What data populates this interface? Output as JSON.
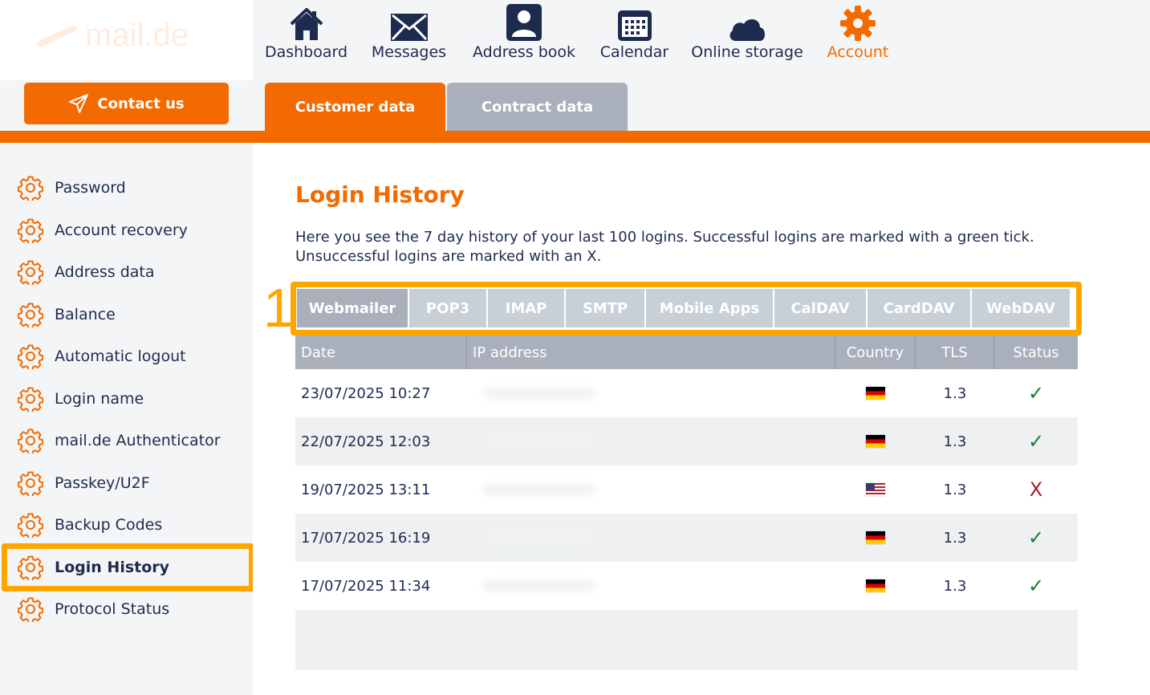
{
  "logo": {
    "text": "mail.de"
  },
  "contact_button": {
    "label": "Contact us"
  },
  "nav": [
    {
      "label": "Dashboard",
      "icon": "house-icon"
    },
    {
      "label": "Messages",
      "icon": "envelope-icon"
    },
    {
      "label": "Address book",
      "icon": "person-card-icon"
    },
    {
      "label": "Calendar",
      "icon": "calendar-icon"
    },
    {
      "label": "Online storage",
      "icon": "cloud-icon"
    },
    {
      "label": "Account",
      "icon": "gear-icon",
      "active": true
    }
  ],
  "tabs": [
    {
      "label": "Customer data",
      "active": true
    },
    {
      "label": "Contract data",
      "active": false
    }
  ],
  "sidebar": {
    "items": [
      {
        "label": "Password"
      },
      {
        "label": "Account recovery"
      },
      {
        "label": "Address data"
      },
      {
        "label": "Balance"
      },
      {
        "label": "Automatic logout"
      },
      {
        "label": "Login name"
      },
      {
        "label": "mail.de Authenticator"
      },
      {
        "label": "Passkey/U2F"
      },
      {
        "label": "Backup Codes"
      },
      {
        "label": "Login History",
        "active": true
      },
      {
        "label": "Protocol Status"
      }
    ]
  },
  "main": {
    "title": "Login History",
    "description": "Here you see the 7 day history of your last 100 logins. Successful logins are marked with a green tick. Unsuccessful logins are marked with an X.",
    "step_number": "1",
    "protocol_tabs": [
      {
        "label": "Webmailer",
        "active": true
      },
      {
        "label": "POP3"
      },
      {
        "label": "IMAP"
      },
      {
        "label": "SMTP"
      },
      {
        "label": "Mobile Apps"
      },
      {
        "label": "CalDAV"
      },
      {
        "label": "CardDAV"
      },
      {
        "label": "WebDAV"
      }
    ],
    "table": {
      "headers": [
        "Date",
        "IP address",
        "Country",
        "TLS",
        "Status"
      ],
      "rows": [
        {
          "date": "23/07/2025 10:27",
          "country": "DE",
          "tls": "1.3",
          "status": "✓",
          "success": true
        },
        {
          "date": "22/07/2025 12:03",
          "country": "DE",
          "tls": "1.3",
          "status": "✓",
          "success": true
        },
        {
          "date": "19/07/2025 13:11",
          "country": "US",
          "tls": "1.3",
          "status": "X",
          "success": false
        },
        {
          "date": "17/07/2025 16:19",
          "country": "DE",
          "tls": "1.3",
          "status": "✓",
          "success": true
        },
        {
          "date": "17/07/2025 11:34",
          "country": "DE",
          "tls": "1.3",
          "status": "✓",
          "success": true
        }
      ]
    }
  },
  "colors": {
    "accent": "#f26a00",
    "navy": "#1d2b4f",
    "highlight": "#ffa500",
    "success": "#1a7a2e",
    "failure": "#a51c30"
  }
}
